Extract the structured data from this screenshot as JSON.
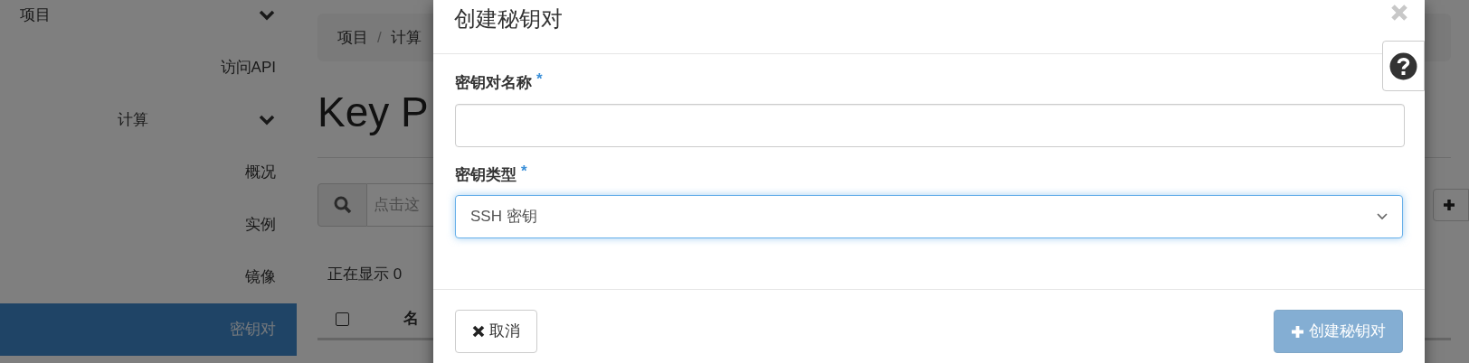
{
  "sidebar": {
    "items": [
      {
        "label": "项目",
        "kind": "group",
        "expanded": true,
        "children": [
          {
            "label": "访问API",
            "kind": "link",
            "selected": false
          },
          {
            "label": "计算",
            "kind": "group",
            "expanded": true,
            "children": [
              {
                "label": "概况",
                "kind": "link",
                "selected": false
              },
              {
                "label": "实例",
                "kind": "link",
                "selected": false
              },
              {
                "label": "镜像",
                "kind": "link",
                "selected": false
              },
              {
                "label": "密钥对",
                "kind": "link",
                "selected": true
              }
            ]
          }
        ]
      }
    ]
  },
  "page": {
    "breadcrumb": {
      "separator": "/",
      "items": [
        "项目",
        "计算"
      ]
    },
    "heading": "Key P",
    "search": {
      "placeholder": "点击这"
    },
    "status": "正在显示 0",
    "table": {
      "select_all": {
        "checked": false
      },
      "columns": [
        "名"
      ]
    }
  },
  "modal": {
    "title": "创建秘钥对",
    "fields": [
      {
        "label": "密钥对名称",
        "required_mark": "*",
        "kind": "text",
        "focused": false
      },
      {
        "label": "密钥类型",
        "required_mark": "*",
        "kind": "select",
        "value": "SSH 密钥",
        "focused": true
      }
    ],
    "buttons": [
      {
        "label": "取消",
        "kind": "default",
        "disabled": false
      },
      {
        "label": "创建秘钥对",
        "kind": "primary",
        "disabled": true
      }
    ]
  }
}
